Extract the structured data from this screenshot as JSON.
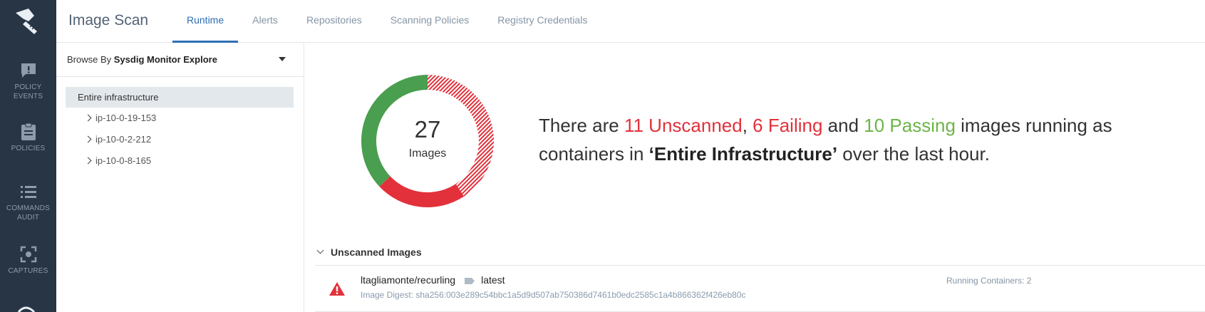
{
  "rail": {
    "items": [
      {
        "icon": "policy-events-icon",
        "label": "POLICY\nEVENTS"
      },
      {
        "icon": "policies-icon",
        "label": "POLICIES"
      },
      {
        "icon": "commands-audit-icon",
        "label": "COMMANDS\nAUDIT"
      },
      {
        "icon": "captures-icon",
        "label": "CAPTURES"
      }
    ]
  },
  "header": {
    "title": "Image Scan",
    "tabs": [
      {
        "label": "Runtime",
        "active": true
      },
      {
        "label": "Alerts",
        "active": false
      },
      {
        "label": "Repositories",
        "active": false
      },
      {
        "label": "Scanning Policies",
        "active": false
      },
      {
        "label": "Registry Credentials",
        "active": false
      }
    ]
  },
  "browse": {
    "prefix": "Browse By",
    "value": "Sysdig Monitor Explore",
    "root": "Entire infrastructure",
    "nodes": [
      "ip-10-0-19-153",
      "ip-10-0-2-212",
      "ip-10-0-8-165"
    ]
  },
  "summary": {
    "total": "27",
    "total_label": "Images",
    "unscanned_count": 11,
    "failing_count": 6,
    "passing_count": 10,
    "t1": "There are ",
    "unscanned": "11 Unscanned",
    "t2": ", ",
    "failing": "6 Failing",
    "t3": " and ",
    "passing": "10 Passing",
    "t4": " images running as containers in ",
    "scope": "‘Entire Infrastructure’",
    "t5": " over the last hour."
  },
  "colors": {
    "unscanned": "#e2313b",
    "failing": "#e2313b",
    "passing": "#4a9e4f",
    "accent": "#2d6fb3"
  },
  "unscanned_section": {
    "title": "Unscanned Images",
    "images": [
      {
        "name": "ltagliamonte/recurling",
        "tag": "latest",
        "digest_label": "Image Digest: ",
        "digest": "sha256:003e289c54bbc1a5d9d507ab750386d7461b0edc2585c1a4b866362f426eb80c",
        "running": "Running Containers: 2"
      }
    ]
  }
}
